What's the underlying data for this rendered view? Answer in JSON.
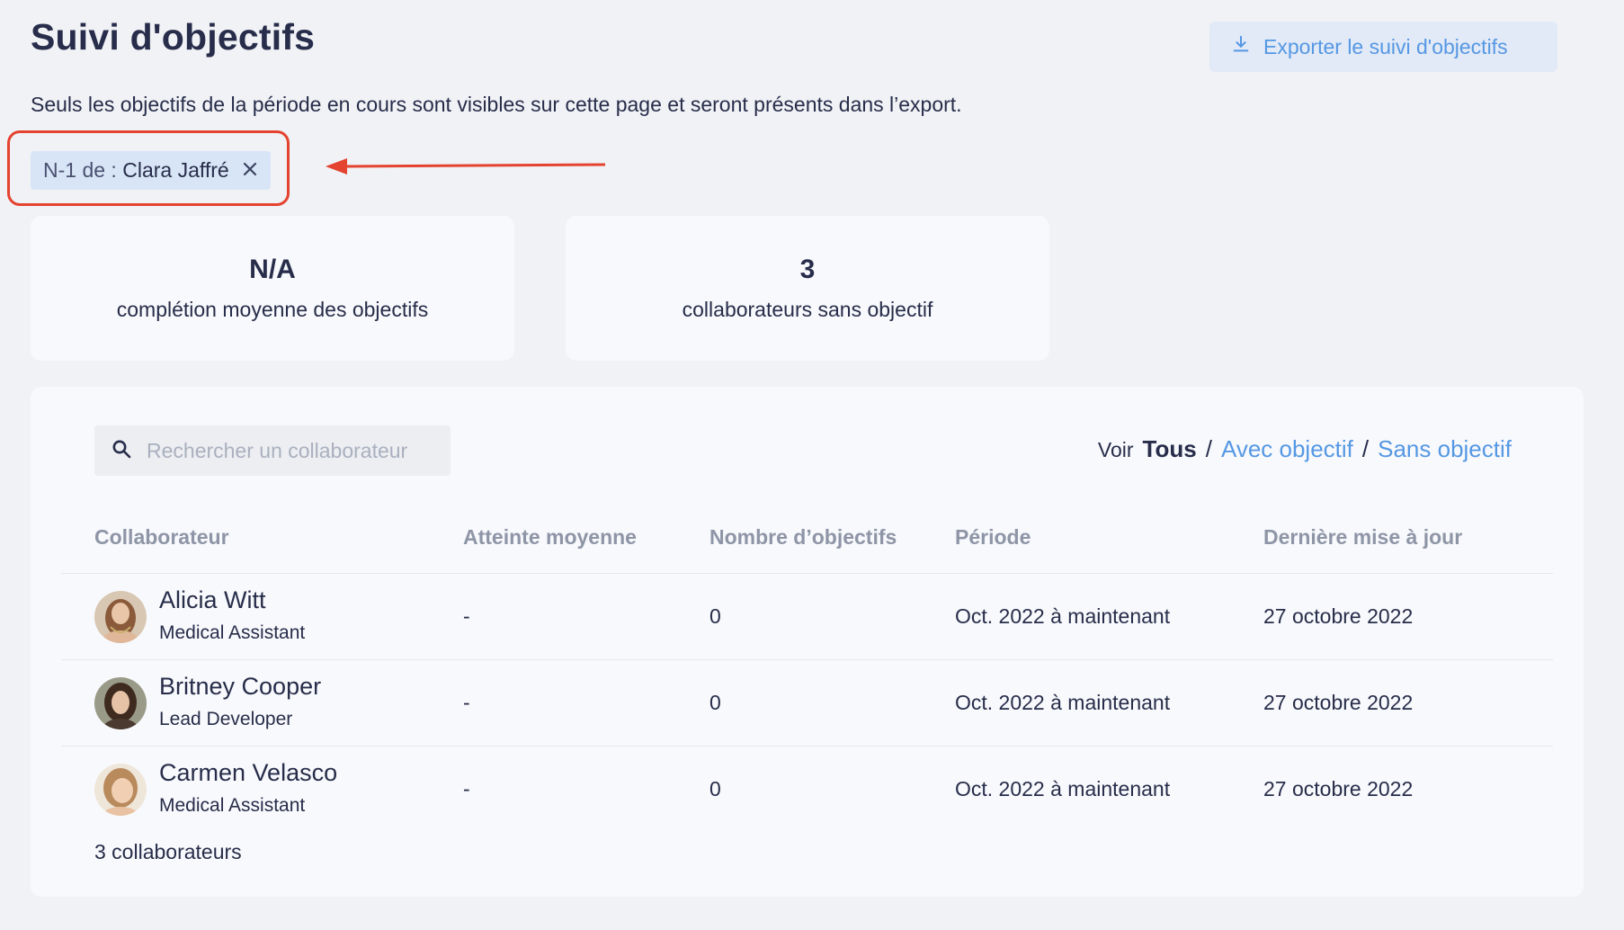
{
  "header": {
    "title": "Suivi d'objectifs",
    "export_label": "Exporter le suivi d'objectifs",
    "export_icon": "download-icon",
    "subtitle": "Seuls les objectifs de la période en cours sont visibles sur cette page et seront présents dans l’export."
  },
  "filter_chip": {
    "prefix": "N-1 de :",
    "value": "Clara Jaffré",
    "close_icon": "close-icon"
  },
  "stats": [
    {
      "value": "N/A",
      "label": "complétion moyenne des objectifs"
    },
    {
      "value": "3",
      "label": "collaborateurs sans objectif"
    }
  ],
  "search": {
    "placeholder": "Rechercher un collaborateur",
    "value": ""
  },
  "view_filter": {
    "prefix": "Voir",
    "options": [
      "Tous",
      "Avec objectif",
      "Sans objectif"
    ],
    "selected": "Tous"
  },
  "table": {
    "columns": [
      "Collaborateur",
      "Atteinte moyenne",
      "Nombre d’objectifs",
      "Période",
      "Dernière mise à jour"
    ],
    "rows": [
      {
        "name": "Alicia Witt",
        "role": "Medical Assistant",
        "attainment": "-",
        "count": "0",
        "period": "Oct. 2022 à maintenant",
        "updated": "27 octobre 2022"
      },
      {
        "name": "Britney Cooper",
        "role": "Lead Developer",
        "attainment": "-",
        "count": "0",
        "period": "Oct. 2022 à maintenant",
        "updated": "27 octobre 2022"
      },
      {
        "name": "Carmen Velasco",
        "role": "Medical Assistant",
        "attainment": "-",
        "count": "0",
        "period": "Oct. 2022 à maintenant",
        "updated": "27 octobre 2022"
      }
    ],
    "footer": "3 collaborateurs"
  },
  "colors": {
    "accent": "#5598e3",
    "annotation": "#e4432f",
    "chip_bg": "#d8e5f7",
    "text": "#272d4a",
    "muted": "#8e95a6"
  }
}
